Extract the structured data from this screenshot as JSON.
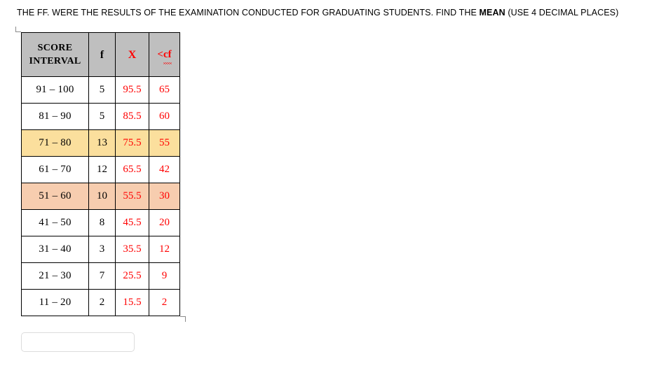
{
  "prompt": {
    "before_bold": "THE FF. WERE THE RESULTS OF THE EXAMINATION CONDUCTED FOR GRADUATING STUDENTS. FIND THE ",
    "bold": "MEAN",
    "after_bold": " (USE 4 DECIMAL PLACES)"
  },
  "table": {
    "headers": {
      "interval": "SCORE INTERVAL",
      "interval_line1": "SCORE",
      "interval_line2": "INTERVAL",
      "f": "f",
      "x": "X",
      "cf_prefix": "<",
      "cf_word": "cf"
    },
    "rows": [
      {
        "interval": "91 – 100",
        "f": "5",
        "x": "95.5",
        "cf": "65",
        "highlight": "none"
      },
      {
        "interval": "81 – 90",
        "f": "5",
        "x": "85.5",
        "cf": "60",
        "highlight": "none"
      },
      {
        "interval": "71 – 80",
        "f": "13",
        "x": "75.5",
        "cf": "55",
        "highlight": "yellow"
      },
      {
        "interval": "61 – 70",
        "f": "12",
        "x": "65.5",
        "cf": "42",
        "highlight": "none"
      },
      {
        "interval": "51 – 60",
        "f": "10",
        "x": "55.5",
        "cf": "30",
        "highlight": "peach"
      },
      {
        "interval": "41 – 50",
        "f": "8",
        "x": "45.5",
        "cf": "20",
        "highlight": "none"
      },
      {
        "interval": "31 – 40",
        "f": "3",
        "x": "35.5",
        "cf": "12",
        "highlight": "none"
      },
      {
        "interval": "21 – 30",
        "f": "7",
        "x": "25.5",
        "cf": "9",
        "highlight": "none"
      },
      {
        "interval": "11 – 20",
        "f": "2",
        "x": "15.5",
        "cf": "2",
        "highlight": "none"
      }
    ]
  },
  "answer": {
    "value": "",
    "placeholder": ""
  },
  "colors": {
    "header_fill": "#bfbfbf",
    "red_text": "#ff0000",
    "highlight_yellow": "#fbdf9d",
    "highlight_peach": "#f7cdaf",
    "grid_line": "#000000",
    "input_border": "#dcdcdc"
  }
}
